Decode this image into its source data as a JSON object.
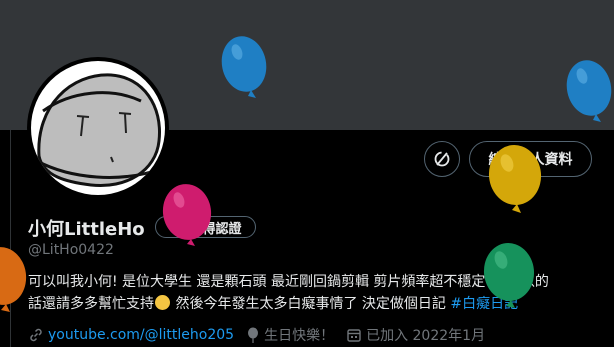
{
  "header": {
    "edit_profile_label": "編輯個人資料",
    "icon_button": "refresh-icon"
  },
  "profile": {
    "name": "小何LittleHo",
    "badge_label": "獲得認證",
    "handle": "@LitHo0422",
    "bio_part1": "可以叫我小何! 是位大學生  還是顆石頭 最近剛回鍋剪輯 剪片頻率超不穩定",
    "bio_part2": " 可以的",
    "bio_part3": "話還請多多幫忙支持",
    "bio_part4": " 然後今年發生太多白癡事情了 決定做個日記 ",
    "bio_hashtag": "#白癡日記",
    "website": "youtube.com/@littleho205",
    "birthday_text": "生日快樂！",
    "joined": "已加入 2022年1月"
  },
  "colors": {
    "background": "#000000",
    "banner": "#333639",
    "link": "#1d9bf0",
    "muted": "#71767b",
    "balloon_blue": "#1f7fc4",
    "balloon_pink": "#cf1c6e",
    "balloon_yellow": "#d4a70a",
    "balloon_green": "#16925c",
    "balloon_orange": "#d86a14"
  }
}
